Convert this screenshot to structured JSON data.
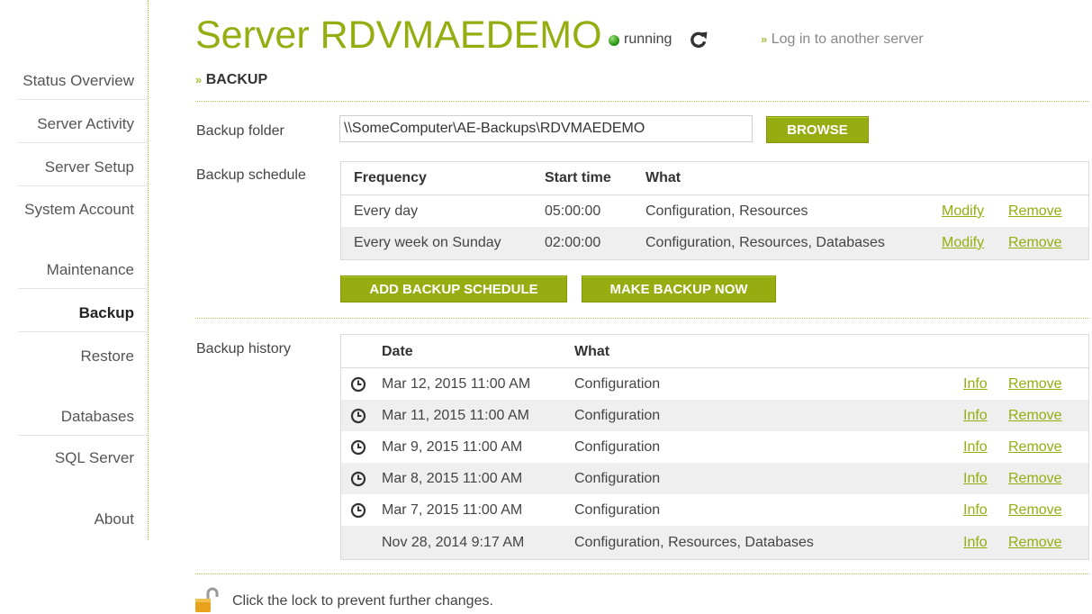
{
  "sidebar": {
    "items": [
      {
        "label": "Status Overview"
      },
      {
        "label": "Server Activity"
      },
      {
        "label": "Server Setup"
      },
      {
        "label": "System Account"
      },
      {
        "label": "Maintenance"
      },
      {
        "label": "Backup",
        "active": true
      },
      {
        "label": "Restore"
      },
      {
        "label": "Databases"
      },
      {
        "label": "SQL Server"
      },
      {
        "label": "About"
      }
    ]
  },
  "header": {
    "title": "Server RDVMAEDEMO",
    "status": "running",
    "login_link": "Log in to another server",
    "section": "BACKUP"
  },
  "backup_folder": {
    "label": "Backup folder",
    "value": "\\\\SomeComputer\\AE-Backups\\RDVMAEDEMO",
    "browse_label": "BROWSE"
  },
  "schedule": {
    "label": "Backup schedule",
    "columns": {
      "frequency": "Frequency",
      "start": "Start time",
      "what": "What"
    },
    "rows": [
      {
        "frequency": "Every day",
        "start": "05:00:00",
        "what": "Configuration, Resources",
        "modify": "Modify",
        "remove": "Remove"
      },
      {
        "frequency": "Every week on Sunday",
        "start": "02:00:00",
        "what": "Configuration, Resources, Databases",
        "modify": "Modify",
        "remove": "Remove"
      }
    ],
    "add_label": "ADD BACKUP SCHEDULE",
    "now_label": "MAKE BACKUP NOW"
  },
  "history": {
    "label": "Backup history",
    "columns": {
      "date": "Date",
      "what": "What"
    },
    "rows": [
      {
        "scheduled": true,
        "date": "Mar 12, 2015 11:00 AM",
        "what": "Configuration",
        "info": "Info",
        "remove": "Remove"
      },
      {
        "scheduled": true,
        "date": "Mar 11, 2015 11:00 AM",
        "what": "Configuration",
        "info": "Info",
        "remove": "Remove"
      },
      {
        "scheduled": true,
        "date": "Mar 9, 2015 11:00 AM",
        "what": "Configuration",
        "info": "Info",
        "remove": "Remove"
      },
      {
        "scheduled": true,
        "date": "Mar 8, 2015 11:00 AM",
        "what": "Configuration",
        "info": "Info",
        "remove": "Remove"
      },
      {
        "scheduled": true,
        "date": "Mar 7, 2015 11:00 AM",
        "what": "Configuration",
        "info": "Info",
        "remove": "Remove"
      },
      {
        "scheduled": false,
        "date": "Nov 28, 2014 9:17 AM",
        "what": "Configuration, Resources, Databases",
        "info": "Info",
        "remove": "Remove"
      }
    ]
  },
  "footer": {
    "lock_text": "Click the lock to prevent further changes.",
    "lock_icon": "unlocked-padlock-icon"
  },
  "colors": {
    "accent": "#95ad10",
    "text": "#444444",
    "row_alt": "#efefef"
  }
}
